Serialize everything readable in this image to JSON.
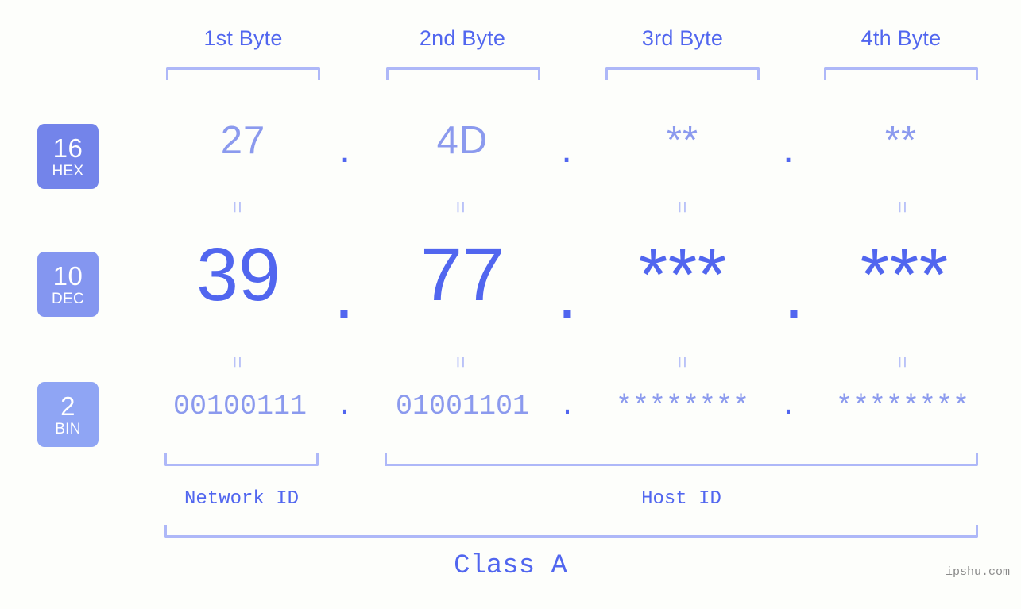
{
  "background_color": "#fdfefb",
  "accent_color": "#5166ef",
  "accent_light": "#8b9aee",
  "bracket_color": "#aeb8f8",
  "headers": {
    "byte1": "1st Byte",
    "byte2": "2nd Byte",
    "byte3": "3rd Byte",
    "byte4": "4th Byte"
  },
  "bases": [
    {
      "num": "16",
      "name": "HEX",
      "color": "#7384ea"
    },
    {
      "num": "10",
      "name": "DEC",
      "color": "#8496f0"
    },
    {
      "num": "2",
      "name": "BIN",
      "color": "#8fa5f4"
    }
  ],
  "rows": {
    "hex": {
      "label_num": "16",
      "label_name": "HEX",
      "values": [
        "27",
        "4D",
        "**",
        "**"
      ],
      "separators": [
        ".",
        ".",
        "."
      ]
    },
    "dec": {
      "label_num": "10",
      "label_name": "DEC",
      "values": [
        "39",
        "77",
        "***",
        "***"
      ],
      "separators": [
        ".",
        ".",
        "."
      ]
    },
    "bin": {
      "label_num": "2",
      "label_name": "BIN",
      "values": [
        "00100111",
        "01001101",
        "********",
        "********"
      ],
      "separators": [
        ".",
        ".",
        "."
      ]
    }
  },
  "equality_marks": {
    "mark": "=",
    "count_per_row_gap": 4
  },
  "footer": {
    "network_id": "Network ID",
    "host_id": "Host ID",
    "class_label": "Class A",
    "watermark": "ipshu.com"
  }
}
